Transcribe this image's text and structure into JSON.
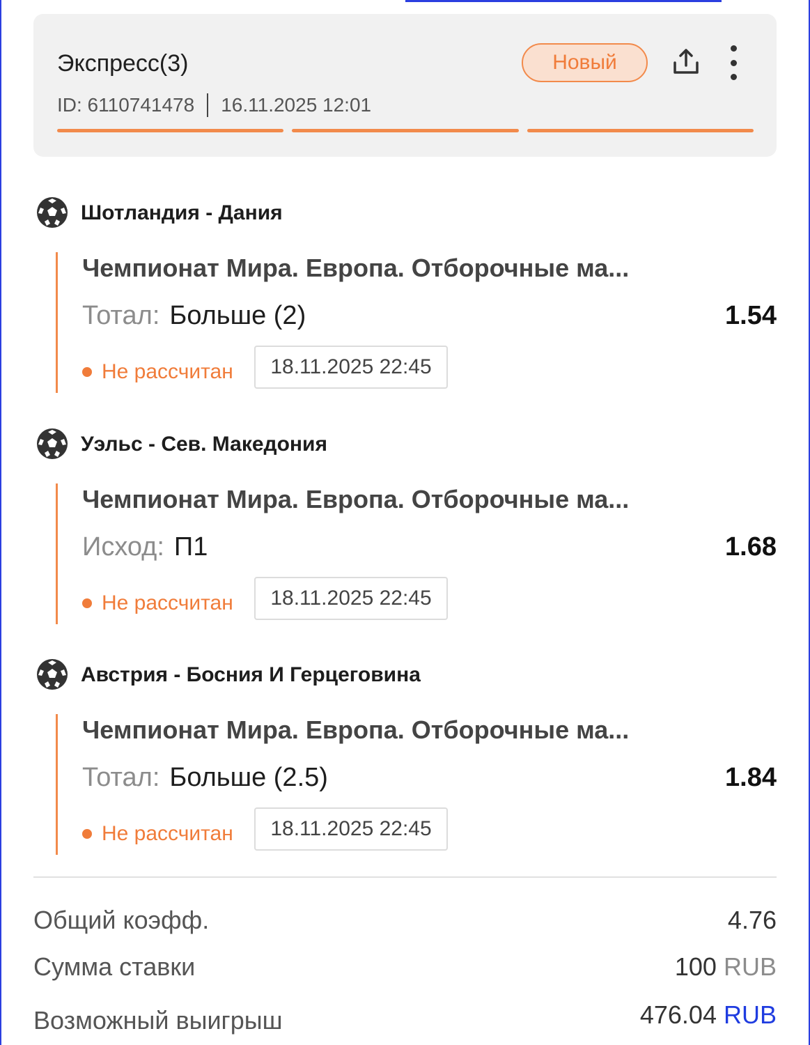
{
  "header": {
    "title": "Экспресс(3)",
    "id_label": "ID: 6110741478",
    "datetime": "16.11.2025 12:01",
    "status_badge": "Новый",
    "accent_color": "#f28a4b"
  },
  "events": [
    {
      "match": "Шотландия - Дания",
      "league": "Чемпионат Мира. Европа. Отборочные ма...",
      "bet_type": "Тотал:",
      "bet_value": "Больше (2)",
      "odds": "1.54",
      "status": "Не рассчитан",
      "date": "18.11.2025 22:45",
      "icon": "soccer-ball-icon"
    },
    {
      "match": "Уэльс - Сев. Македония",
      "league": "Чемпионат Мира. Европа. Отборочные ма...",
      "bet_type": "Исход:",
      "bet_value": "П1",
      "odds": "1.68",
      "status": "Не рассчитан",
      "date": "18.11.2025 22:45",
      "icon": "soccer-ball-icon"
    },
    {
      "match": "Австрия - Босния И Герцеговина",
      "league": "Чемпионат Мира. Европа. Отборочные ма...",
      "bet_type": "Тотал:",
      "bet_value": "Больше (2.5)",
      "odds": "1.84",
      "status": "Не рассчитан",
      "date": "18.11.2025 22:45",
      "icon": "soccer-ball-icon"
    }
  ],
  "summary": {
    "total_odds_label": "Общий коэфф.",
    "total_odds": "4.76",
    "stake_label": "Сумма ставки",
    "stake_amount": "100",
    "stake_currency": "RUB",
    "win_label": "Возможный выигрыш",
    "win_amount": "476.04",
    "win_currency": "RUB"
  }
}
